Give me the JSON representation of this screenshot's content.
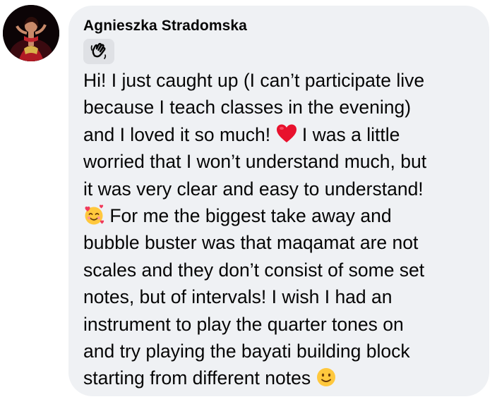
{
  "comment": {
    "author": "Agnieszka Stradomska",
    "badge_icon": "waving-hand-icon",
    "lines": [
      "Hi! I just caught up (I can’t participate live",
      "because I teach classes in the evening)",
      "and I loved it so much! ",
      " I was a little",
      "worried that I won’t understand much, but",
      "it was very clear and easy to understand!",
      " For me the biggest take away and",
      "bubble buster was that maqamat are not",
      "scales and they don’t consist of some set",
      "notes, but of intervals! I wish I had an",
      "instrument to play the quarter tones on",
      "and try playing the bayati building block",
      "starting from different notes "
    ],
    "emojis": [
      "red-heart-emoji",
      "smiling-face-with-hearts-emoji",
      "slightly-smiling-face-emoji"
    ]
  },
  "colors": {
    "bubble": "#eff1f4",
    "text": "#050505",
    "badge": "#dfe1e5"
  }
}
